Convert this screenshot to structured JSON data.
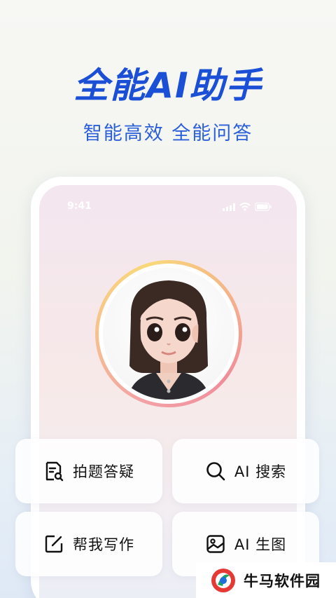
{
  "hero": {
    "title": "全能AI助手",
    "subtitle": "智能高效 全能问答"
  },
  "status_bar": {
    "time": "9:41"
  },
  "features": [
    {
      "label": "拍题答疑",
      "icon": "document-search-icon"
    },
    {
      "label": "AI 搜索",
      "icon": "search-icon"
    },
    {
      "label": "帮我写作",
      "icon": "edit-icon"
    },
    {
      "label": "AI 生图",
      "icon": "image-icon"
    }
  ],
  "watermark": {
    "text": "牛马软件园"
  },
  "colors": {
    "brand_blue": "#1a4fd6",
    "ring_pink": "#f08d99",
    "ring_yellow": "#f8d978"
  }
}
